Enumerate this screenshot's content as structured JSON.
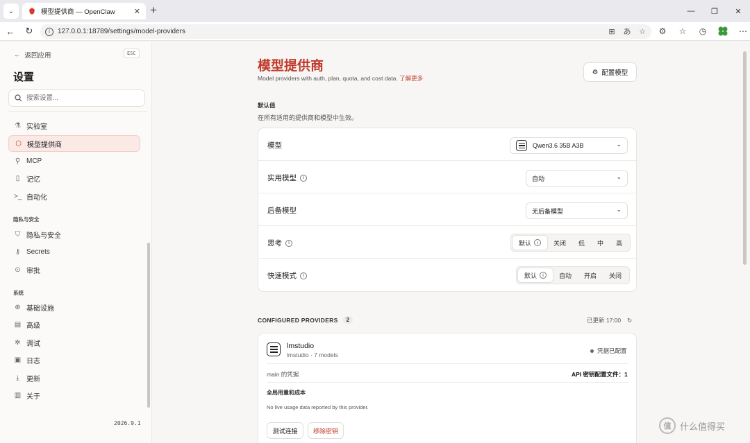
{
  "browser": {
    "tab_title": "模型提供商 — OpenClaw",
    "url": "127.0.0.1:18789/settings/model-providers"
  },
  "sidebar": {
    "back_label": "返回应用",
    "esc_label": "ESC",
    "title": "设置",
    "search_placeholder": "搜索设置...",
    "items_main": [
      {
        "label": "实验室",
        "icon": "flask-icon"
      },
      {
        "label": "模型提供商",
        "icon": "cube-icon",
        "active": true
      },
      {
        "label": "MCP",
        "icon": "plug-icon"
      },
      {
        "label": "记忆",
        "icon": "notebook-icon"
      },
      {
        "label": "自动化",
        "icon": "terminal-icon"
      }
    ],
    "section_privacy": "隐私与安全",
    "items_privacy": [
      {
        "label": "隐私与安全",
        "icon": "shield-icon"
      },
      {
        "label": "Secrets",
        "icon": "key-icon"
      },
      {
        "label": "审批",
        "icon": "check-circle-icon"
      }
    ],
    "section_system": "系统",
    "items_system": [
      {
        "label": "基础设施",
        "icon": "globe-icon"
      },
      {
        "label": "高级",
        "icon": "document-icon"
      },
      {
        "label": "调试",
        "icon": "bug-icon"
      },
      {
        "label": "日志",
        "icon": "log-icon"
      },
      {
        "label": "更新",
        "icon": "download-icon"
      },
      {
        "label": "关于",
        "icon": "info-doc-icon"
      }
    ],
    "version": "2026.9.1"
  },
  "main": {
    "title": "模型提供商",
    "subtitle": "Model providers with auth, plan, quota, and cost data.",
    "learn_more": "了解更多",
    "config_button": "配置模型",
    "defaults_label": "默认值",
    "defaults_desc": "在所有适用的提供商和模型中生效。",
    "rows": {
      "model": {
        "label": "模型",
        "value": "Qwen3.6 35B A3B"
      },
      "utility": {
        "label": "实用模型",
        "value": "自动"
      },
      "fallback": {
        "label": "后备模型",
        "value": "无后备模型"
      },
      "thinking": {
        "label": "思考",
        "options": [
          "默认",
          "关闭",
          "低",
          "中",
          "高"
        ],
        "selected": "默认"
      },
      "fast": {
        "label": "快速模式",
        "options": [
          "默认",
          "自动",
          "开启",
          "关闭"
        ],
        "selected": "默认"
      }
    },
    "providers_header": "CONFIGURED PROVIDERS",
    "providers_count": "2",
    "updated_label": "已更新 17:00",
    "provider": {
      "name": "lmstudio",
      "meta": "lmstudio · 7 models",
      "status": "凭据已配置",
      "cred_label": "main 的凭据",
      "cred_value": "API 密钥配置文件：1",
      "usage_title": "全局用量和成本",
      "usage_desc": "No live usage data reported by this provider.",
      "test_button": "测试连接",
      "remove_button": "移除密钥"
    }
  },
  "watermark": "什么值得买",
  "colors": {
    "accent": "#c0392b",
    "active_bg": "#fbe9e6"
  }
}
